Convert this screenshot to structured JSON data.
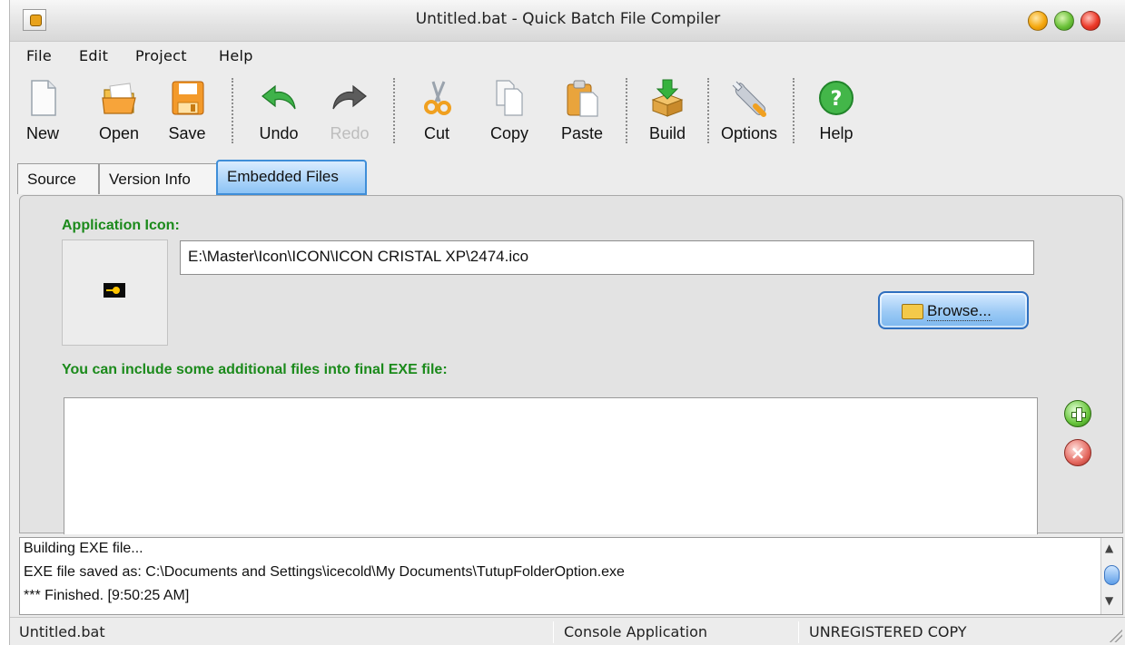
{
  "window": {
    "title": "Untitled.bat - Quick Batch File Compiler",
    "controls": {
      "minimize": "minimize",
      "maximize": "maximize",
      "close": "close"
    }
  },
  "menu": [
    "File",
    "Edit",
    "Project",
    "Help"
  ],
  "toolbar": {
    "new": "New",
    "open": "Open",
    "save": "Save",
    "undo": "Undo",
    "redo": "Redo",
    "cut": "Cut",
    "copy": "Copy",
    "paste": "Paste",
    "build": "Build",
    "options": "Options",
    "help": "Help",
    "redo_enabled": false
  },
  "tabs": [
    {
      "label": "Source",
      "active": false
    },
    {
      "label": "Version Info",
      "active": false
    },
    {
      "label": "Embedded Files",
      "active": true
    }
  ],
  "embedded": {
    "app_icon_label": "Application Icon:",
    "icon_path": "E:\\Master\\Icon\\ICON\\ICON CRISTAL XP\\2474.ico",
    "browse_label": "Browse...",
    "additional_files_label": "You can include some additional files into final EXE file:",
    "files": []
  },
  "log": [
    "Building EXE file...",
    "EXE file saved as: C:\\Documents and Settings\\icecold\\My Documents\\TutupFolderOption.exe",
    "*** Finished. [9:50:25 AM]"
  ],
  "status": {
    "file": "Untitled.bat",
    "app_type": "Console Application",
    "registration": "UNREGISTERED COPY"
  },
  "colors": {
    "section_label": "#1b8a1b",
    "active_tab": "#8cc3f5",
    "accent": "#3f8ed8"
  }
}
